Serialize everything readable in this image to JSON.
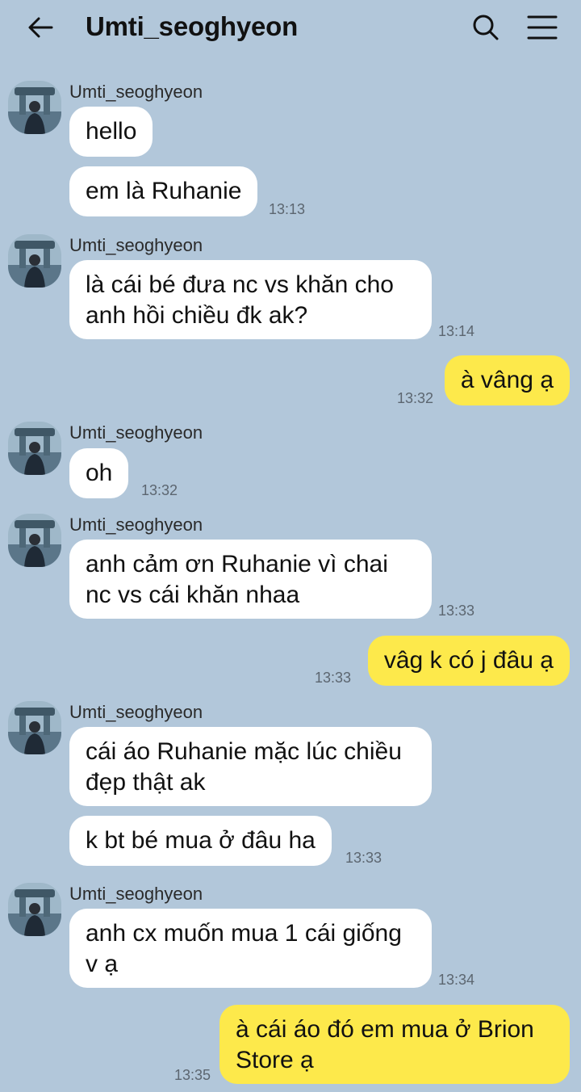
{
  "header": {
    "title": "Umti_seoghyeon"
  },
  "messages": [
    {
      "sender": "Umti_seoghyeon",
      "bubbles": [
        "hello",
        "em là Ruhanie"
      ],
      "time": "13:13"
    },
    {
      "sender": "Umti_seoghyeon",
      "bubbles": [
        "là cái bé đưa nc vs khăn cho anh hồi chiều đk ak?"
      ],
      "time": "13:14"
    },
    {
      "self": true,
      "text": "à vâng ạ",
      "time": "13:32"
    },
    {
      "sender": "Umti_seoghyeon",
      "bubbles": [
        "oh"
      ],
      "time": "13:32"
    },
    {
      "sender": "Umti_seoghyeon",
      "bubbles": [
        "anh cảm ơn Ruhanie vì chai nc vs cái khăn nhaa"
      ],
      "time": "13:33"
    },
    {
      "self": true,
      "text": "vâg k có j đâu ạ",
      "time": "13:33"
    },
    {
      "sender": "Umti_seoghyeon",
      "bubbles": [
        "cái áo Ruhanie mặc lúc chiều đẹp thật ak",
        "k bt bé mua ở đâu ha"
      ],
      "time": "13:33"
    },
    {
      "sender": "Umti_seoghyeon",
      "bubbles": [
        "anh cx muốn mua 1 cái giống v ạ"
      ],
      "time": "13:34"
    },
    {
      "self": true,
      "text": "à cái áo đó em mua ở Brion Store ạ",
      "time": "13:35"
    }
  ]
}
